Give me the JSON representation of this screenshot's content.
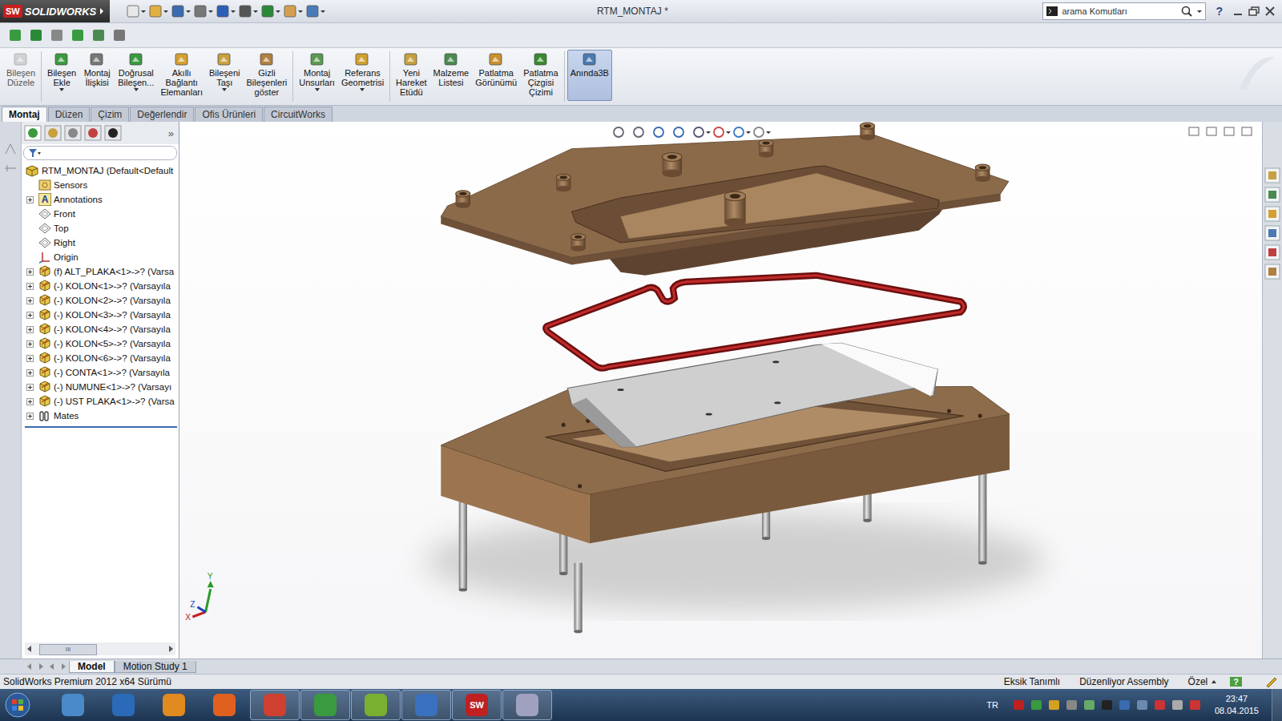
{
  "window": {
    "app": "SOLIDWORKS",
    "logo_mark": "SW",
    "title": "RTM_MONTAJ *"
  },
  "search": {
    "placeholder": "arama Komutları"
  },
  "help": "?",
  "ribbon": [
    {
      "label": [
        "Bileşen",
        "Düzele"
      ],
      "dropdown": false,
      "selected": false,
      "disabled": true
    },
    {
      "label": [
        "Bileşen",
        "Ekle"
      ],
      "dropdown": true,
      "selected": false,
      "disabled": false
    },
    {
      "label": [
        "Montaj",
        "İlişkisi"
      ],
      "dropdown": false,
      "selected": false,
      "disabled": false
    },
    {
      "label": [
        "Doğrusal",
        "Bileşen..."
      ],
      "dropdown": true,
      "selected": false,
      "disabled": false
    },
    {
      "label": [
        "Akıllı",
        "Bağlantı",
        "Elemanları"
      ],
      "dropdown": false,
      "selected": false,
      "disabled": false
    },
    {
      "label": [
        "Bileşeni",
        "Taşı"
      ],
      "dropdown": true,
      "selected": false,
      "disabled": false
    },
    {
      "label": [
        "Gizli",
        "Bileşenleri",
        "göster"
      ],
      "dropdown": false,
      "selected": false,
      "disabled": false
    },
    {
      "label": [
        "Montaj",
        "Unsurları"
      ],
      "dropdown": true,
      "selected": false,
      "disabled": false
    },
    {
      "label": [
        "Referans",
        "Geometrisi"
      ],
      "dropdown": true,
      "selected": false,
      "disabled": false
    },
    {
      "label": [
        "Yeni",
        "Hareket",
        "Etüdü"
      ],
      "dropdown": false,
      "selected": false,
      "disabled": false
    },
    {
      "label": [
        "Malzeme",
        "Listesi"
      ],
      "dropdown": false,
      "selected": false,
      "disabled": false
    },
    {
      "label": [
        "Patlatma",
        "Görünümü"
      ],
      "dropdown": false,
      "selected": false,
      "disabled": false
    },
    {
      "label": [
        "Patlatma",
        "Çizgisi",
        "Çizimi"
      ],
      "dropdown": false,
      "selected": false,
      "disabled": false
    },
    {
      "label": [
        "Anında3B"
      ],
      "dropdown": false,
      "selected": true,
      "disabled": false
    }
  ],
  "tabs": [
    {
      "label": "Montaj",
      "selected": true
    },
    {
      "label": "Düzen",
      "selected": false
    },
    {
      "label": "Çizim",
      "selected": false
    },
    {
      "label": "Değerlendir",
      "selected": false
    },
    {
      "label": "Ofis Ürünleri",
      "selected": false
    },
    {
      "label": "CircuitWorks",
      "selected": false
    }
  ],
  "tree": {
    "collapse": "»",
    "root": "RTM_MONTAJ  (Default<Default",
    "items": [
      {
        "label": "Sensors",
        "kind": "sensor",
        "expandable": false
      },
      {
        "label": "Annotations",
        "kind": "annotation",
        "expandable": true,
        "icon_text": "A"
      },
      {
        "label": "Front",
        "kind": "plane",
        "expandable": false
      },
      {
        "label": "Top",
        "kind": "plane",
        "expandable": false
      },
      {
        "label": "Right",
        "kind": "plane",
        "expandable": false
      },
      {
        "label": "Origin",
        "kind": "origin",
        "expandable": false
      },
      {
        "label": "(f) ALT_PLAKA<1>->? (Varsa",
        "kind": "part",
        "expandable": true
      },
      {
        "label": "(-) KOLON<1>->? (Varsayıla",
        "kind": "part",
        "expandable": true
      },
      {
        "label": "(-) KOLON<2>->? (Varsayıla",
        "kind": "part",
        "expandable": true
      },
      {
        "label": "(-) KOLON<3>->? (Varsayıla",
        "kind": "part",
        "expandable": true
      },
      {
        "label": "(-) KOLON<4>->? (Varsayıla",
        "kind": "part",
        "expandable": true
      },
      {
        "label": "(-) KOLON<5>->? (Varsayıla",
        "kind": "part",
        "expandable": true
      },
      {
        "label": "(-) KOLON<6>->? (Varsayıla",
        "kind": "part",
        "expandable": true
      },
      {
        "label": "(-) CONTA<1>->? (Varsayıla",
        "kind": "part",
        "expandable": true
      },
      {
        "label": "(-) NUMUNE<1>->? (Varsayı",
        "kind": "part",
        "expandable": true
      },
      {
        "label": "(-) UST PLAKA<1>->? (Varsa",
        "kind": "part",
        "expandable": true
      },
      {
        "label": "Mates",
        "kind": "mates",
        "expandable": true
      }
    ],
    "scroll_grip": "III"
  },
  "triad": {
    "y": "Y",
    "z": "Z",
    "x": "X"
  },
  "bottom_tabs": [
    {
      "label": "Model",
      "selected": true
    },
    {
      "label": "Motion Study 1",
      "selected": false
    }
  ],
  "status_bar": {
    "version": "SolidWorks Premium 2012 x64 Sürümü",
    "state": "Eksik Tanımlı",
    "mode": "Düzenliyor Assembly",
    "units": "Özel",
    "help": "?"
  },
  "taskbar": {
    "apps": [
      {
        "running": false,
        "text": ""
      },
      {
        "running": false,
        "text": ""
      },
      {
        "running": false,
        "text": ""
      },
      {
        "running": false,
        "text": ""
      },
      {
        "running": true,
        "text": ""
      },
      {
        "running": true,
        "text": ""
      },
      {
        "running": true,
        "text": ""
      },
      {
        "running": true,
        "text": ""
      },
      {
        "running": true,
        "text": "SW"
      },
      {
        "running": true,
        "text": ""
      }
    ],
    "lang": "TR",
    "time": "23:47",
    "date": "08.04.2015"
  }
}
